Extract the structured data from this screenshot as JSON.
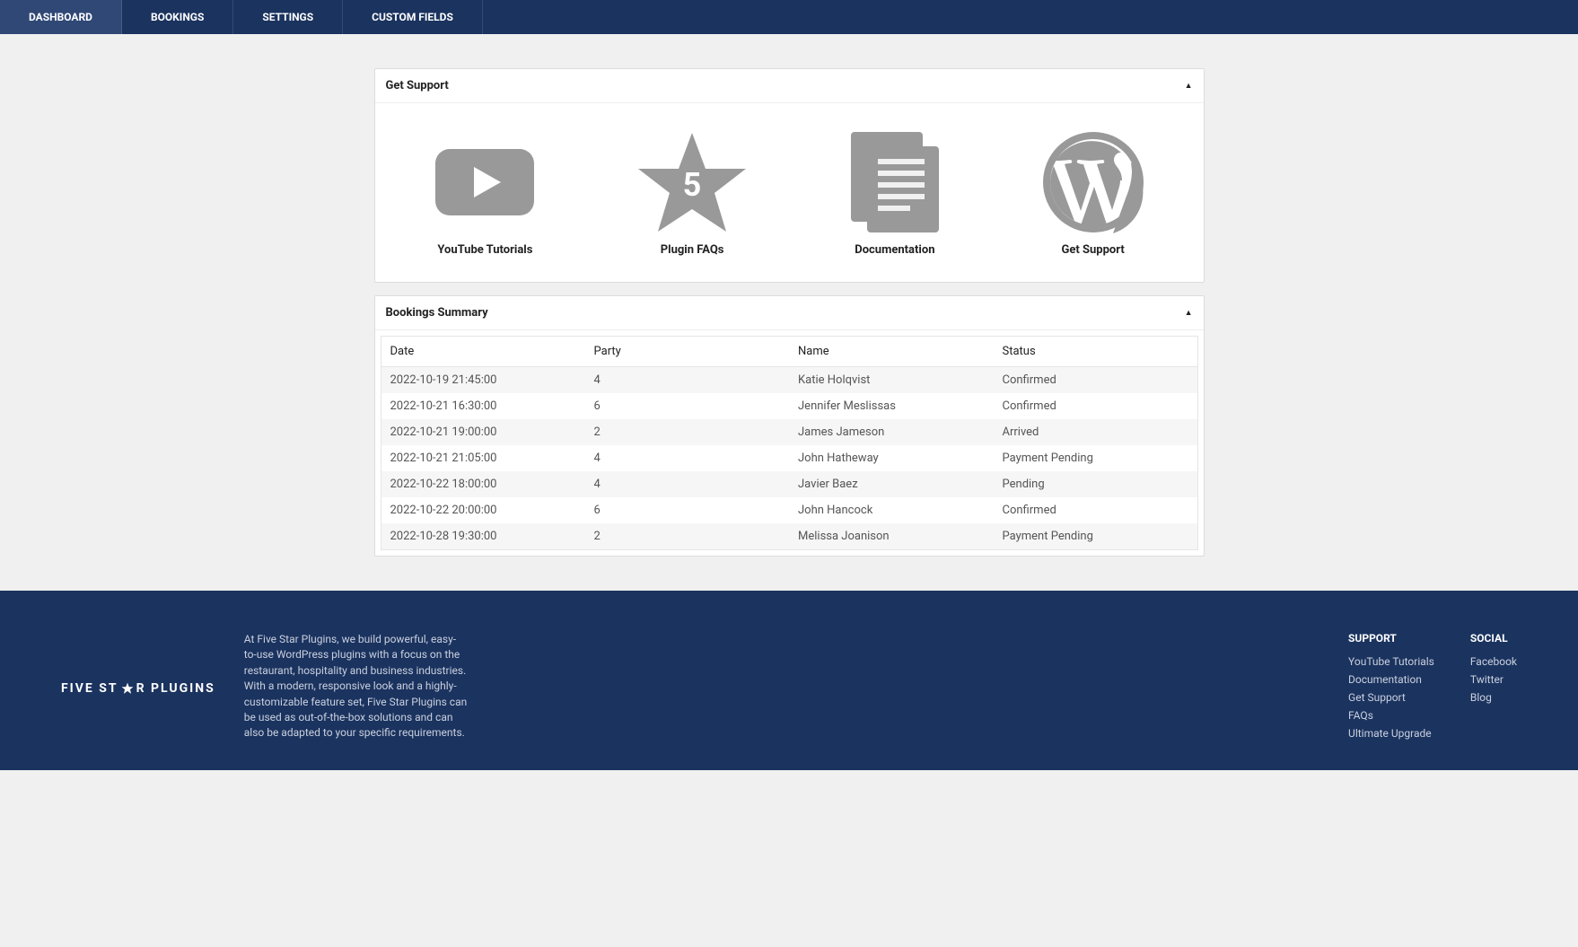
{
  "nav": {
    "tabs": [
      {
        "label": "DASHBOARD",
        "active": true
      },
      {
        "label": "BOOKINGS",
        "active": false
      },
      {
        "label": "SETTINGS",
        "active": false
      },
      {
        "label": "CUSTOM FIELDS",
        "active": false
      }
    ]
  },
  "support_panel": {
    "title": "Get Support",
    "items": [
      {
        "label": "YouTube Tutorials",
        "icon": "youtube-icon"
      },
      {
        "label": "Plugin FAQs",
        "icon": "star-5-icon"
      },
      {
        "label": "Documentation",
        "icon": "document-icon"
      },
      {
        "label": "Get Support",
        "icon": "wordpress-icon"
      }
    ]
  },
  "bookings_panel": {
    "title": "Bookings Summary",
    "columns": [
      "Date",
      "Party",
      "Name",
      "Status"
    ],
    "rows": [
      {
        "date": "2022-10-19 21:45:00",
        "party": "4",
        "name": "Katie Holqvist",
        "status": "Confirmed"
      },
      {
        "date": "2022-10-21 16:30:00",
        "party": "6",
        "name": "Jennifer Meslissas",
        "status": "Confirmed"
      },
      {
        "date": "2022-10-21 19:00:00",
        "party": "2",
        "name": "James Jameson",
        "status": "Arrived"
      },
      {
        "date": "2022-10-21 21:05:00",
        "party": "4",
        "name": "John Hatheway",
        "status": "Payment Pending"
      },
      {
        "date": "2022-10-22 18:00:00",
        "party": "4",
        "name": "Javier Baez",
        "status": "Pending"
      },
      {
        "date": "2022-10-22 20:00:00",
        "party": "6",
        "name": "John Hancock",
        "status": "Confirmed"
      },
      {
        "date": "2022-10-28 19:30:00",
        "party": "2",
        "name": "Melissa Joanison",
        "status": "Payment Pending"
      }
    ]
  },
  "footer": {
    "logo_pre": "FIVE ST",
    "logo_post": "R PLUGINS",
    "about": "At Five Star Plugins, we build powerful, easy-to-use WordPress plugins with a focus on the restaurant, hospitality and business industries. With a modern, responsive look and a highly-customizable feature set, Five Star Plugins can be used as out-of-the-box solutions and can also be adapted to your specific requirements.",
    "support": {
      "title": "SUPPORT",
      "links": [
        "YouTube Tutorials",
        "Documentation",
        "Get Support",
        "FAQs",
        "Ultimate Upgrade"
      ]
    },
    "social": {
      "title": "SOCIAL",
      "links": [
        "Facebook",
        "Twitter",
        "Blog"
      ]
    }
  }
}
